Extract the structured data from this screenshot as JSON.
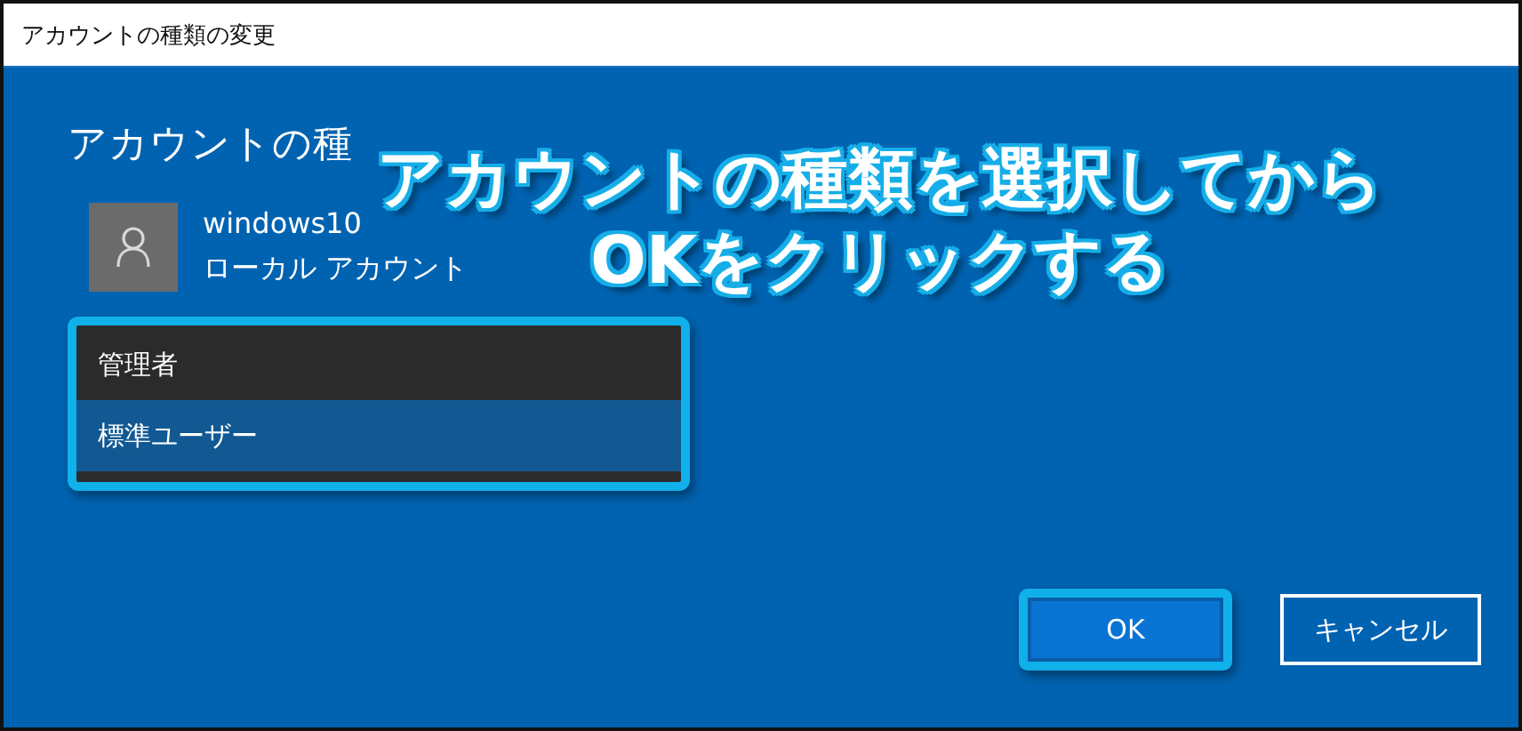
{
  "window": {
    "title": "アカウントの種類の変更"
  },
  "heading": "アカウントの種",
  "account": {
    "name": "windows10",
    "type": "ローカル アカウント"
  },
  "dropdown": {
    "highlighted": true,
    "options": [
      {
        "label": "管理者",
        "selected": false
      },
      {
        "label": "標準ユーザー",
        "selected": true
      }
    ]
  },
  "annotation": {
    "lines": [
      "アカウントの種類を選択してから",
      "OKをクリックする"
    ]
  },
  "buttons": [
    {
      "label": "OK",
      "kind": "primary",
      "highlighted": true
    },
    {
      "label": "キャンセル",
      "kind": "secondary",
      "highlighted": false
    }
  ]
}
